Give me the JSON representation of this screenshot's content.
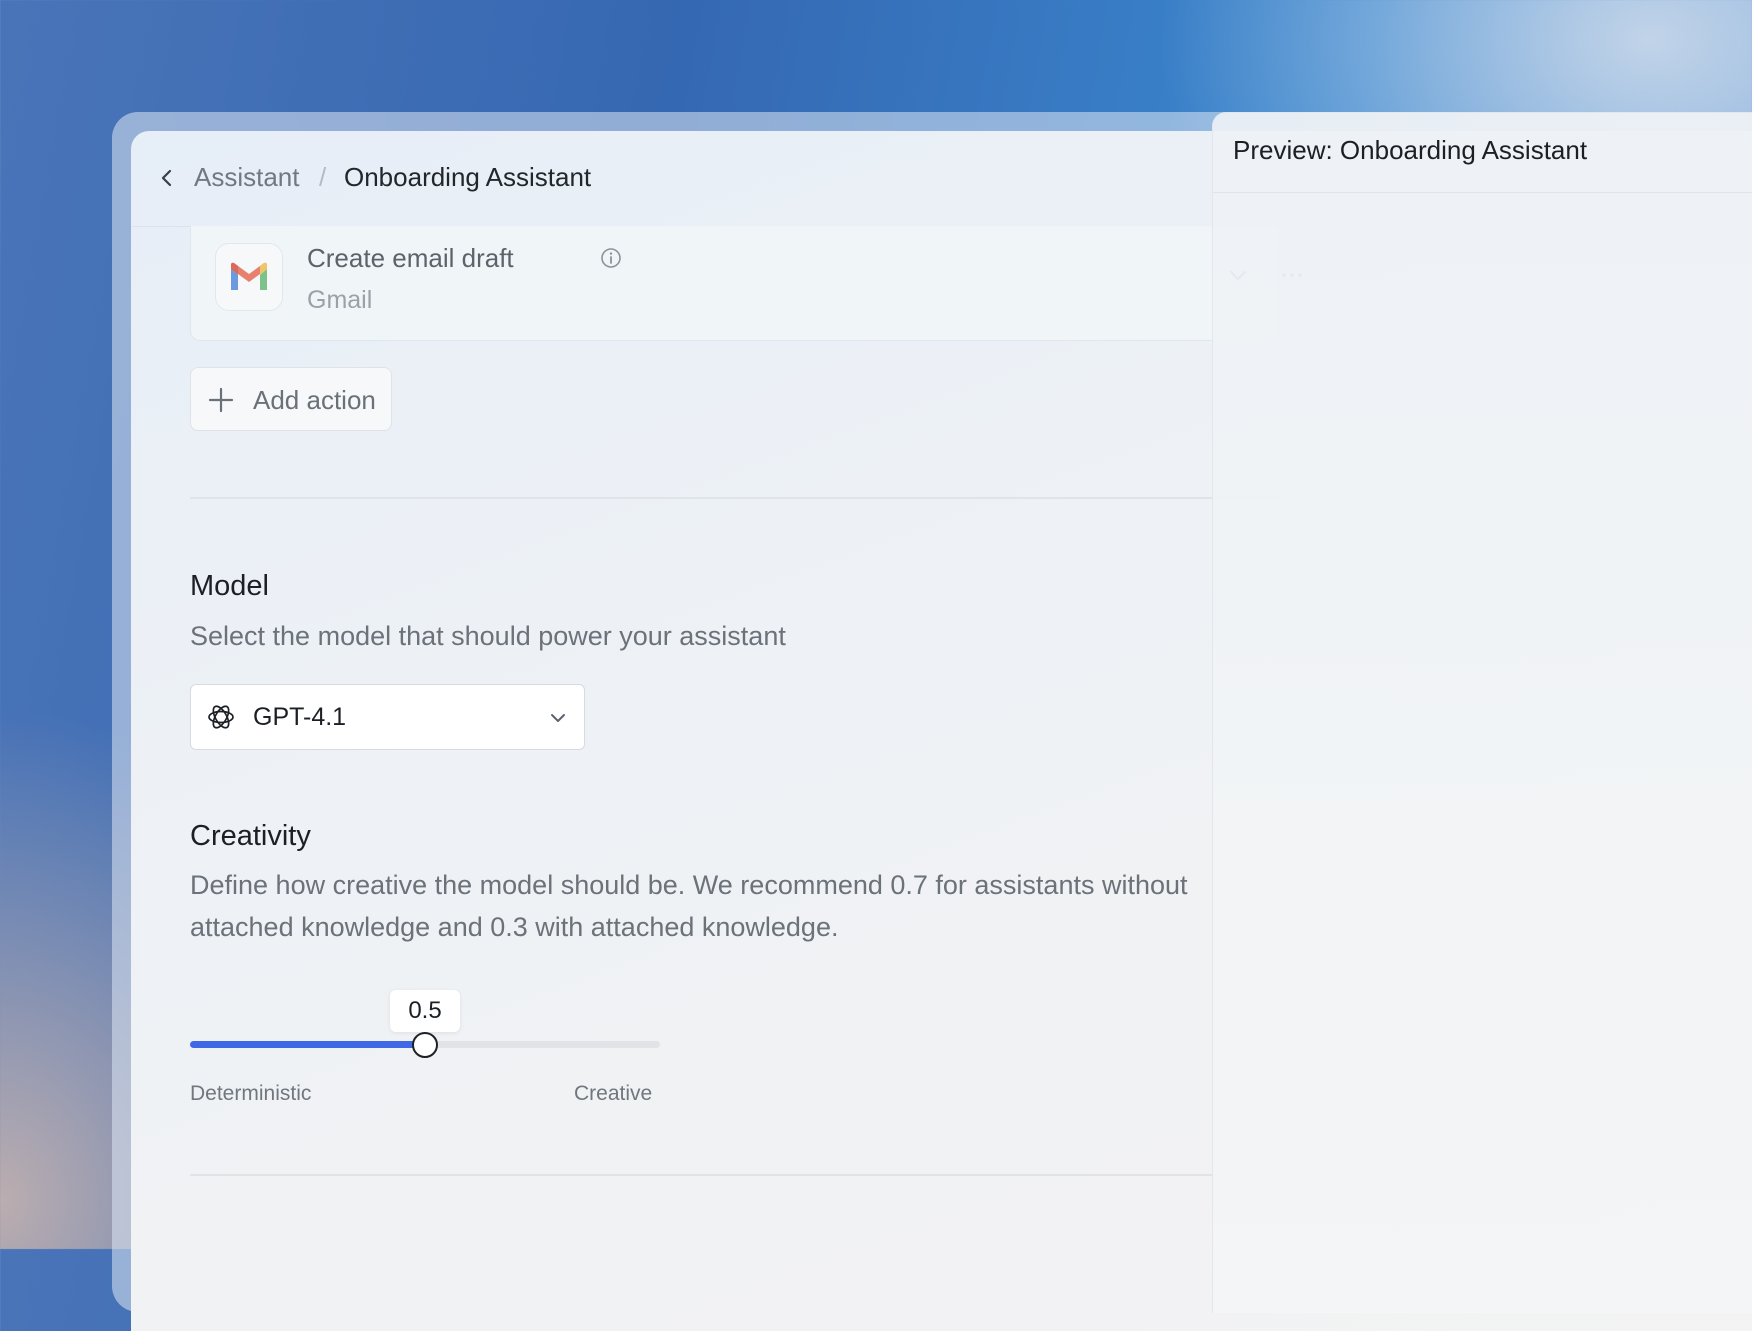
{
  "breadcrumb": {
    "parent": "Assistant",
    "separator": "/",
    "current": "Onboarding Assistant"
  },
  "action_card": {
    "title": "Create email draft",
    "subtitle": "Gmail",
    "icons": {
      "app": "gmail-icon",
      "info": "info-icon",
      "expand": "chevron-down-icon",
      "menu": "more-icon"
    }
  },
  "add_action": {
    "label": "Add action",
    "icon": "plus-icon"
  },
  "model": {
    "title": "Model",
    "description": "Select the model that should power your assistant",
    "selected": "GPT-4.1",
    "icon": "openai-icon"
  },
  "creativity": {
    "title": "Creativity",
    "description": "Define how creative the model should be. We recommend 0.7 for assistants without attached knowledge and 0.3 with attached knowledge.",
    "value_label": "0.5",
    "value": 0.5,
    "min_label": "Deterministic",
    "max_label": "Creative"
  },
  "preview": {
    "title": "Preview: Onboarding Assistant"
  },
  "colors": {
    "accent": "#3f68e6",
    "text": "#1c2025",
    "muted": "#6b7279"
  }
}
